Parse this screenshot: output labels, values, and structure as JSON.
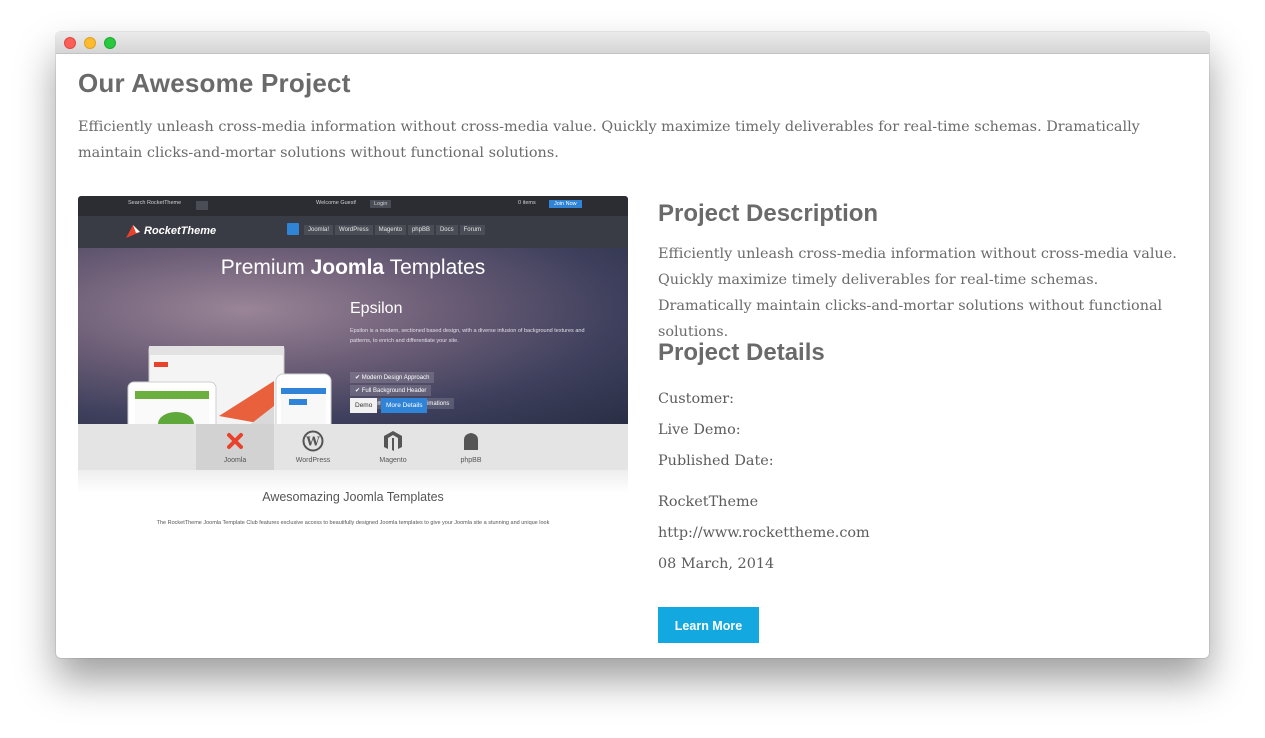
{
  "page": {
    "title": "Our Awesome Project",
    "intro": "Efficiently unleash cross-media information without cross-media value. Quickly maximize timely deliverables for real-time schemas. Dramatically maintain clicks-and-mortar solutions without functional solutions."
  },
  "screenshot": {
    "topbar": {
      "search": "Search RocketTheme",
      "welcome": "Welcome Guest!",
      "login": "Login",
      "cart": "0 items",
      "join": "Join Now"
    },
    "logo": "RocketTheme",
    "nav": [
      "Joomla!",
      "WordPress",
      "Magento",
      "phpBB",
      "Docs",
      "Forum"
    ],
    "hero": {
      "title_light": "Premium ",
      "title_bold": "Joomla",
      "title_end": " Templates",
      "product": "Epsilon",
      "product_desc": "Epsilon is a modern, sectioned based design, with a diverse infusion of background textures and patterns, to enrich and differentiate your site.",
      "features": [
        "Modern Design Approach",
        "Full Background Header",
        "Custom RokSprocket Animations"
      ],
      "demo_label": "Demo",
      "more_label": "More Details"
    },
    "platforms": [
      "Joomla",
      "WordPress",
      "Magento",
      "phpBB"
    ],
    "footer_title": "Awesomazing Joomla Templates",
    "footer_desc": "The RocketTheme Joomla Template Club features exclusive access to beautifully designed Joomla templates to give your Joomla site a stunning and unique look"
  },
  "project": {
    "description_heading": "Project Description",
    "description": "Efficiently unleash cross-media information without cross-media value. Quickly maximize timely deliverables for real-time schemas. Dramatically maintain clicks-and-mortar solutions without functional solutions.",
    "details_heading": "Project Details",
    "labels": {
      "customer": "Customer:",
      "live_demo": "Live Demo:",
      "published": "Published Date:"
    },
    "values": {
      "customer": "RocketTheme",
      "live_demo": "http://www.rockettheme.com",
      "published": "08 March, 2014"
    },
    "button": "Learn More"
  },
  "colors": {
    "accent": "#13a9e0",
    "heading": "#6a6a6a",
    "body_text": "#6b6b6b"
  }
}
